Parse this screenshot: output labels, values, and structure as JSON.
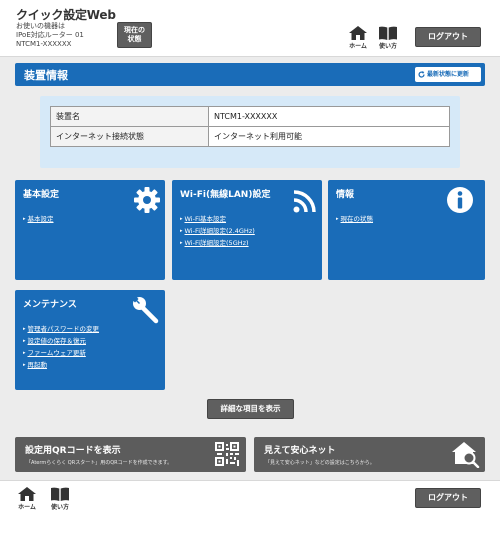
{
  "header": {
    "app_title": "クイック設定Web",
    "device_line1": "お使いの機器は",
    "device_line2": "IPoE対応ルーター 01",
    "device_line3": "NTCM1-XXXXXX",
    "status_line1": "現在の",
    "status_line2": "状態",
    "home_label": "ホーム",
    "help_label": "使い方",
    "logout_label": "ログアウト"
  },
  "device_section": {
    "title": "装置情報",
    "refresh_label": "最新状態に更新",
    "table": [
      {
        "key": "装置名",
        "value": "NTCM1-XXXXXX"
      },
      {
        "key": "インターネット接続状態",
        "value": "インターネット利用可能"
      }
    ]
  },
  "cards": {
    "basic": {
      "title": "基本設定",
      "links": [
        "基本設定"
      ],
      "icon": "gear-icon"
    },
    "wifi": {
      "title": "Wi-Fi(無線LAN)設定",
      "links": [
        "Wi-Fi基本設定",
        "Wi-Fi詳細設定(2.4GHz)",
        "Wi-Fi詳細設定(5GHz)"
      ],
      "icon": "wifi-icon"
    },
    "info": {
      "title": "情報",
      "links": [
        "現在の状態"
      ],
      "icon": "info-icon"
    },
    "maintenance": {
      "title": "メンテナンス",
      "links": [
        "管理者パスワードの変更",
        "設定値の保存＆復元",
        "ファームウェア更新",
        "再起動"
      ],
      "icon": "wrench-icon"
    }
  },
  "detail_button_label": "詳細な項目を表示",
  "bottom_cards": {
    "qr": {
      "title": "設定用QRコードを表示",
      "desc": "「Atermらくらく QRスタート」用のQRコードを作成できます。",
      "icon": "qr-code-icon"
    },
    "safe": {
      "title": "見えて安心ネット",
      "desc": "「見えて安心ネット」などの設定はこちらから。",
      "icon": "house-search-icon"
    }
  },
  "footer": {
    "home_label": "ホーム",
    "help_label": "使い方",
    "logout_label": "ログアウト"
  },
  "colors": {
    "accent_blue": "#1a6cb8",
    "panel_light_blue": "#d6e9f8",
    "dark_button": "#5f5f5f",
    "content_bg": "#ececec"
  }
}
